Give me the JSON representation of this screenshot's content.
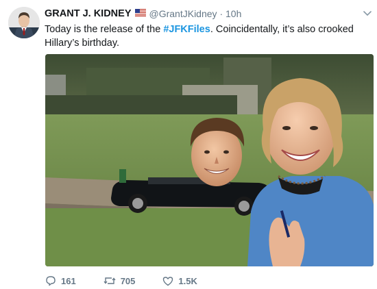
{
  "tweet": {
    "author": {
      "display_name": "GRANT J. KIDNEY",
      "badge_icon": "us-flag-icon",
      "handle": "@GrantJKidney",
      "time": "10h"
    },
    "text_before": "Today is the release of the ",
    "hashtag": "#JFKFiles",
    "text_after": ". Coincidentally, it’s also crooked Hillary’s birthday.",
    "media": {
      "type": "image",
      "subject": "photo-collage-motorcade"
    },
    "actions": {
      "reply": {
        "icon": "reply-icon",
        "count": "161"
      },
      "retweet": {
        "icon": "retweet-icon",
        "count": "705"
      },
      "like": {
        "icon": "heart-icon",
        "count": "1.5K"
      }
    },
    "menu_icon": "chevron-down-icon"
  },
  "colors": {
    "text": "#14171a",
    "secondary": "#657786",
    "link": "#1b95e0"
  }
}
